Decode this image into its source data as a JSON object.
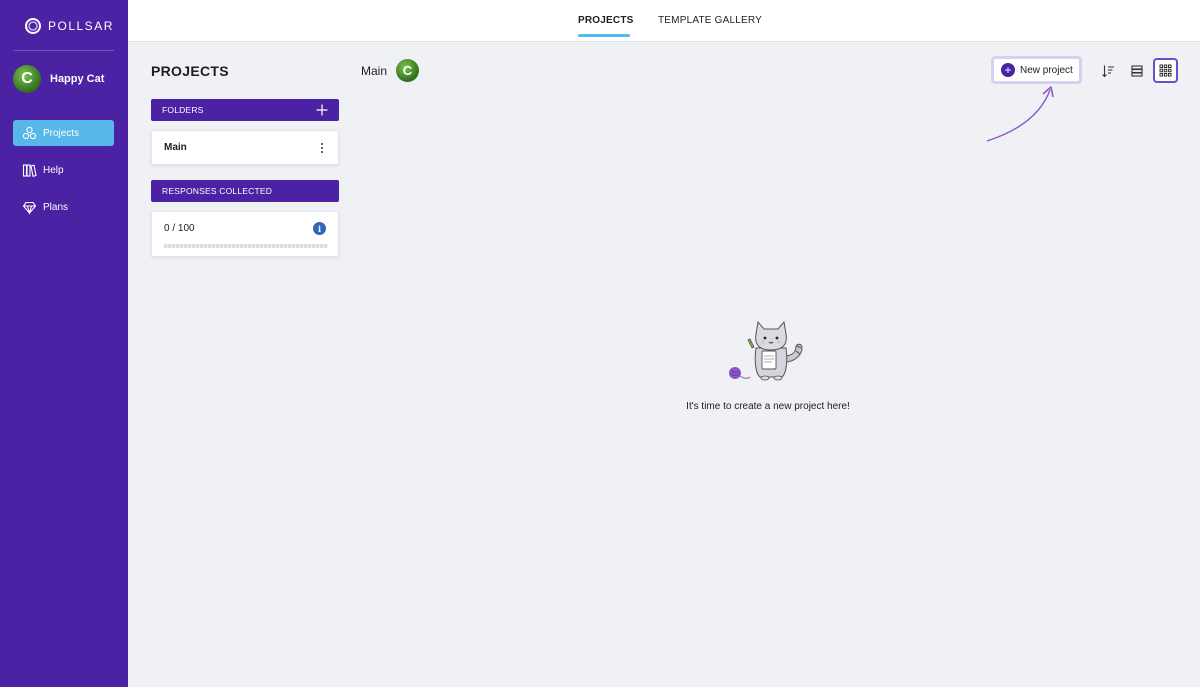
{
  "app": {
    "logo_text": "POLLSAR"
  },
  "user": {
    "initial": "C",
    "name": "Happy Cat"
  },
  "sidebar": {
    "items": [
      {
        "label": "Projects",
        "icon": "projects-icon",
        "active": true
      },
      {
        "label": "Help",
        "icon": "books-icon",
        "active": false
      },
      {
        "label": "Plans",
        "icon": "diamond-icon",
        "active": false
      }
    ]
  },
  "tabs": [
    {
      "label": "PROJECTS",
      "active": true
    },
    {
      "label": "TEMPLATE GALLERY",
      "active": false
    }
  ],
  "page": {
    "title": "PROJECTS"
  },
  "folder_header": {
    "title": "Main",
    "avatar_initial": "C"
  },
  "folders": {
    "header": "FOLDERS",
    "items": [
      {
        "name": "Main"
      }
    ]
  },
  "responses": {
    "header": "RESPONSES COLLECTED",
    "value": "0 / 100",
    "used": 0,
    "limit": 100
  },
  "toolbar": {
    "new_project_label": "New project",
    "icons": [
      "sort-icon",
      "list-view-icon",
      "grid-view-icon"
    ],
    "active_view": "grid"
  },
  "empty_state": {
    "message": "It's time to create a new project here!"
  },
  "colors": {
    "sidebar": "#4a22a3",
    "accent": "#56b7e8",
    "panel_header": "#4a22a3",
    "info": "#3168b2"
  }
}
